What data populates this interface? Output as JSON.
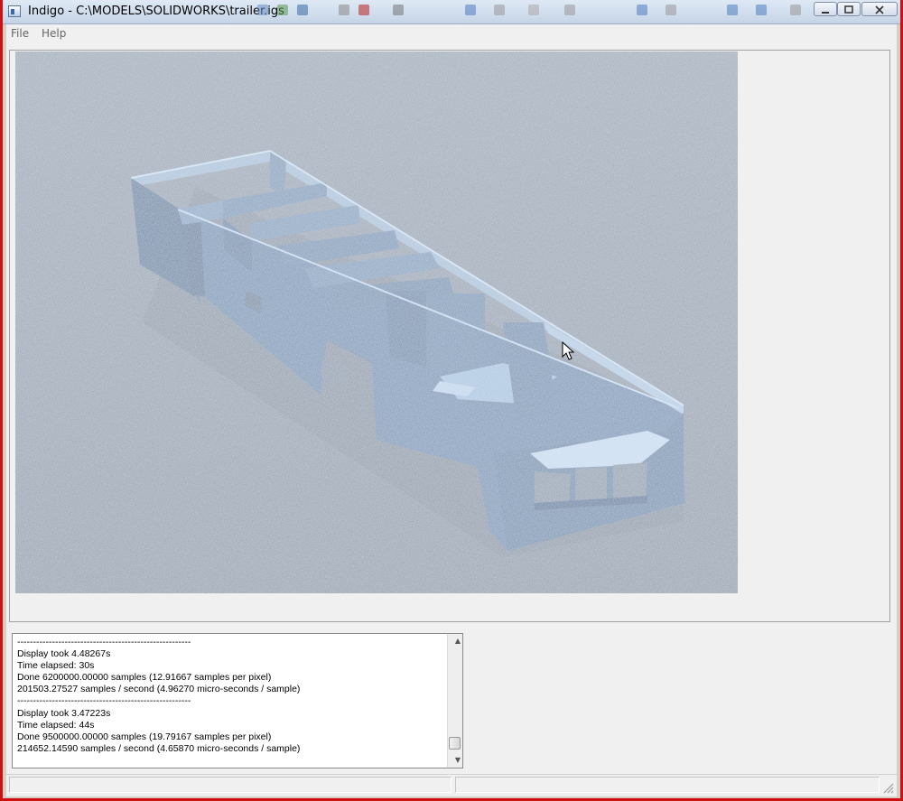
{
  "window": {
    "title": "Indigo - C:\\MODELS\\SOLIDWORKS\\trailer.igs",
    "minimize_label": "",
    "maximize_label": "",
    "close_label": ""
  },
  "menu": {
    "file_label": "File",
    "help_label": "Help"
  },
  "log": {
    "text": "-------------------------------------------------------\nDisplay took 4.48267s\nTime elapsed: 30s\nDone 6200000.00000 samples (12.91667 samples per pixel)\n201503.27527 samples / second (4.96270 micro-seconds / sample)\n-------------------------------------------------------\nDisplay took 3.47223s\nTime elapsed: 44s\nDone 9500000.00000 samples (19.79167 samples per pixel)\n214652.14590 samples / second (4.65870 micro-seconds / sample)"
  },
  "colors": {
    "frame_accent": "#d01010",
    "render_background": "#8f9aa6",
    "model_color": "#7a97b5"
  },
  "icons": {
    "app": "indigo-app-icon",
    "minimize": "minimize-icon",
    "maximize": "maximize-icon",
    "close": "close-icon",
    "cursor": "mouse-pointer-icon",
    "scroll_up": "scroll-up-arrow-icon",
    "scroll_down": "scroll-down-arrow-icon",
    "resize": "resize-grip-icon"
  }
}
